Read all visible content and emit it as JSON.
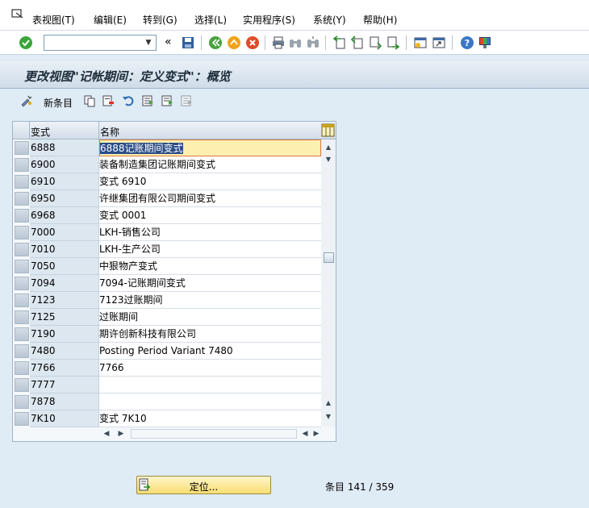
{
  "menu": {
    "items": [
      {
        "label": "表视图(T)"
      },
      {
        "label": "编辑(E)"
      },
      {
        "label": "转到(G)"
      },
      {
        "label": "选择(L)"
      },
      {
        "label": "实用程序(S)"
      },
      {
        "label": "系统(Y)"
      },
      {
        "label": "帮助(H)"
      }
    ]
  },
  "toolbar": {
    "command_value": "",
    "history_glyph": "«"
  },
  "title": "更改视图\"记帐期间：定义变式\"：概览",
  "app_toolbar": {
    "new_entries_label": "新条目"
  },
  "table": {
    "columns": [
      "变式",
      "名称"
    ],
    "rows": [
      {
        "variant": "6888",
        "name": "6888记账期间变式"
      },
      {
        "variant": "6900",
        "name": "装备制造集团记账期间变式"
      },
      {
        "variant": "6910",
        "name": "变式 6910"
      },
      {
        "variant": "6950",
        "name": "许继集团有限公司期间变式"
      },
      {
        "variant": "6968",
        "name": "变式 0001"
      },
      {
        "variant": "7000",
        "name": "LKH-销售公司"
      },
      {
        "variant": "7010",
        "name": "LKH-生产公司"
      },
      {
        "variant": "7050",
        "name": "中狠物产变式"
      },
      {
        "variant": "7094",
        "name": "7094-记账期间变式"
      },
      {
        "variant": "7123",
        "name": "7123过账期间"
      },
      {
        "variant": "7125",
        "name": "过账期间"
      },
      {
        "variant": "7190",
        "name": "期许创新科技有限公司"
      },
      {
        "variant": "7480",
        "name": "Posting Period Variant 7480"
      },
      {
        "variant": "7766",
        "name": "7766"
      },
      {
        "variant": "7777",
        "name": ""
      },
      {
        "variant": "7878",
        "name": ""
      },
      {
        "variant": "7K10",
        "name": "变式 7K10"
      }
    ]
  },
  "footer": {
    "position_button_label": "定位...",
    "entries_text": "条目 141 / 359"
  },
  "colors": {
    "background": "#dfebf5",
    "highlight_cell": "#fcefb0",
    "selection": "#2b4d85",
    "focus_border": "#e07a3a"
  }
}
